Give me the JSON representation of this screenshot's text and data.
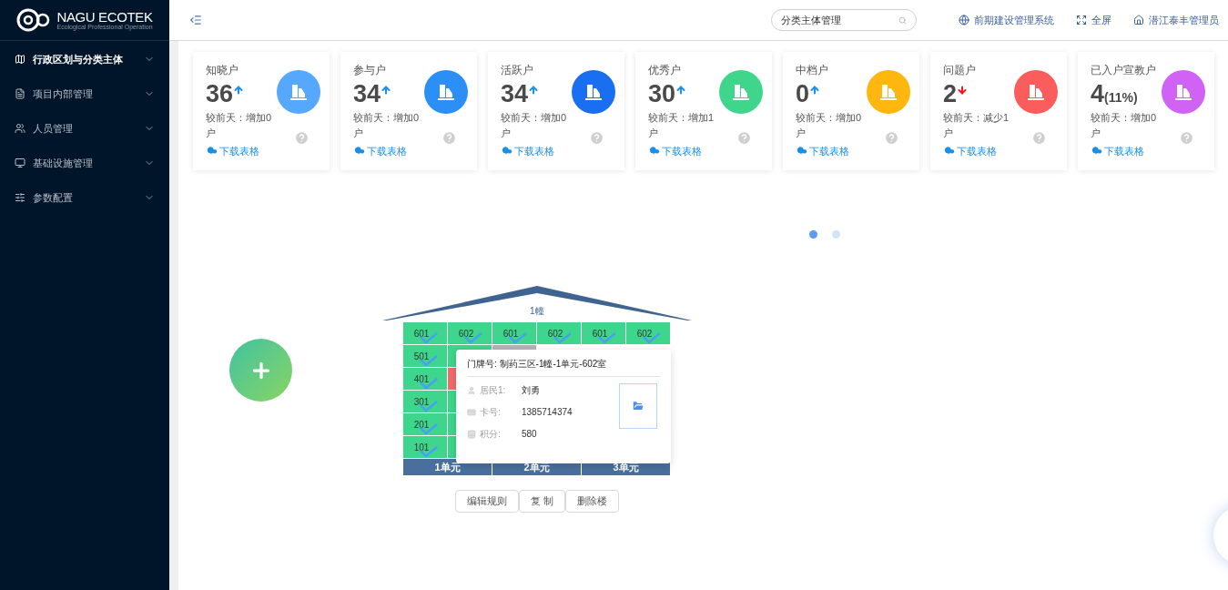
{
  "logo": {
    "name": "NAGU ECOTEK",
    "tagline": "Ecological Professional Operation"
  },
  "sidebar": {
    "items": [
      {
        "label": "行政区划与分类主体",
        "selected": true
      },
      {
        "label": "项目内部管理",
        "selected": false
      },
      {
        "label": "人员管理",
        "selected": false
      },
      {
        "label": "基础设施管理",
        "selected": false
      },
      {
        "label": "参数配置",
        "selected": false
      }
    ]
  },
  "header": {
    "search": {
      "value": "分类主体管理"
    },
    "links": [
      "前期建设管理系统",
      "全屏",
      "潜江泰丰管理员"
    ]
  },
  "stats": [
    {
      "title": "知晓户",
      "value": "36",
      "kind": "up",
      "change": "较前天：增加0户",
      "link": "下载表格",
      "color": "#55a8fd"
    },
    {
      "title": "参与户",
      "value": "34",
      "kind": "up",
      "change": "较前天：增加0户",
      "link": "下载表格",
      "color": "#2b8ff5"
    },
    {
      "title": "活跃户",
      "value": "34",
      "kind": "up",
      "change": "较前天：增加0户",
      "link": "下载表格",
      "color": "#1a6ff0"
    },
    {
      "title": "优秀户",
      "value": "30",
      "kind": "up",
      "change": "较前天：增加1户",
      "link": "下载表格",
      "color": "#3fd68c"
    },
    {
      "title": "中档户",
      "value": "0",
      "kind": "up",
      "change": "较前天：增加0户",
      "link": "下载表格",
      "color": "#ffb70f"
    },
    {
      "title": "问题户",
      "value": "2",
      "kind": "down",
      "change": "较前天：减少1户",
      "link": "下载表格",
      "color": "#fb5c5c"
    },
    {
      "title": "已入户宣教户",
      "value": "4",
      "suffix": "(11%)",
      "kind": "flat",
      "change": "较前天：增加0户",
      "link": "下载表格",
      "color": "#d063f5"
    }
  ],
  "carousel": {
    "dots": [
      {
        "selected": true
      },
      {
        "selected": false
      }
    ]
  },
  "building": {
    "name": "1幢",
    "rows": [
      [
        {
          "room": "601",
          "kind": "ok",
          "checked": true
        },
        {
          "room": "602",
          "kind": "ok",
          "checked": true
        },
        {
          "room": "601",
          "kind": "ok",
          "checked": true
        },
        {
          "room": "602",
          "kind": "ok",
          "checked": true
        },
        {
          "room": "601",
          "kind": "ok",
          "checked": true
        },
        {
          "room": "602",
          "kind": "ok",
          "checked": true
        }
      ],
      [
        {
          "room": "501",
          "kind": "ok",
          "checked": true
        },
        {
          "kind": "ok"
        },
        {
          "kind": "vacant"
        }
      ],
      [
        {
          "room": "401",
          "kind": "ok",
          "checked": true
        },
        {
          "kind": "problem"
        }
      ],
      [
        {
          "room": "301",
          "kind": "ok",
          "checked": true
        },
        {
          "kind": "ok"
        }
      ],
      [
        {
          "room": "201",
          "kind": "ok",
          "checked": true
        },
        {
          "kind": "ok"
        }
      ],
      [
        {
          "room": "101",
          "kind": "ok",
          "checked": true
        },
        {
          "kind": "ok"
        }
      ]
    ],
    "units": [
      "1单元",
      "2单元",
      "3单元"
    ],
    "buttons": [
      "编辑规则",
      "复 制",
      "删除楼"
    ]
  },
  "popup": {
    "title": "门牌号: 制药三区-1幢-1单元-602室",
    "fields": [
      {
        "label": "居民1:",
        "value": "刘勇"
      },
      {
        "label": "卡号:",
        "value": "1385714374"
      },
      {
        "label": "积分:",
        "value": "580"
      }
    ]
  }
}
